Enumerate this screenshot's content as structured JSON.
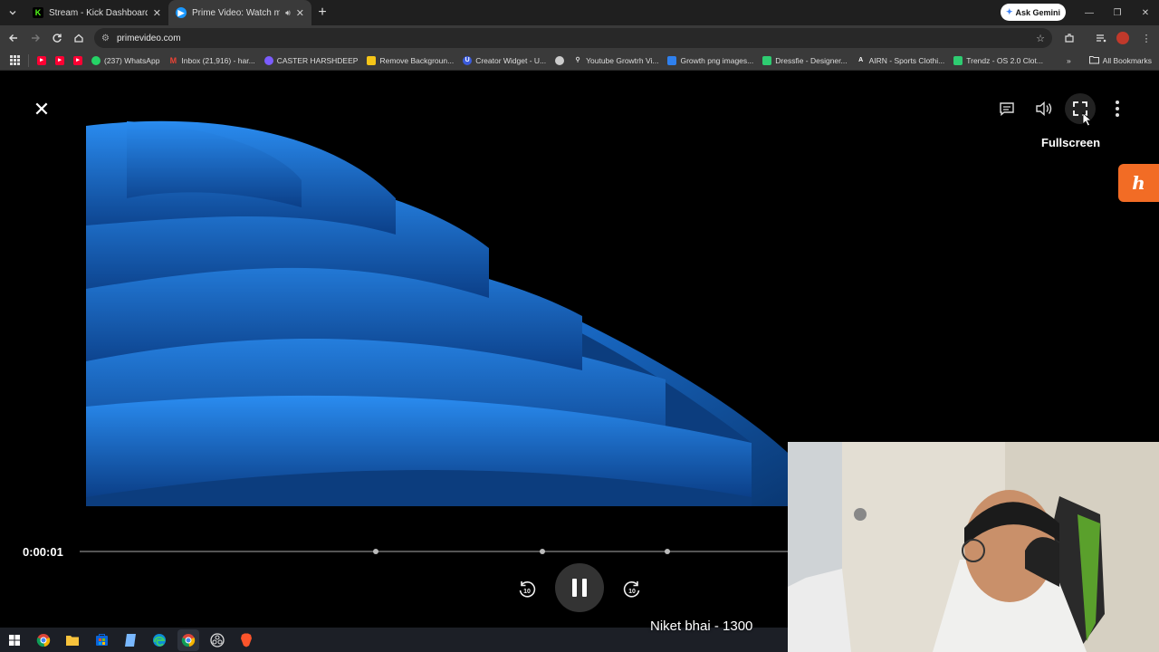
{
  "browser": {
    "tabs": [
      {
        "title": "Stream - Kick Dashboard",
        "favicon": "kick-icon",
        "favicon_color": "#53fc18",
        "active": false
      },
      {
        "title": "Prime Video: Watch movies",
        "favicon": "prime-video-icon",
        "favicon_color": "#1a98ff",
        "active": true
      }
    ],
    "ask_gemini": "Ask Gemini",
    "url": "primevideo.com",
    "bookmarks": [
      {
        "label": "",
        "icon": "youtube-icon",
        "color": "#ff0033"
      },
      {
        "label": "",
        "icon": "youtube-icon",
        "color": "#ff0033"
      },
      {
        "label": "",
        "icon": "youtube-icon",
        "color": "#ff0033"
      },
      {
        "label": "(237) WhatsApp",
        "icon": "whatsapp-icon",
        "color": "#25d366"
      },
      {
        "label": "Inbox (21,916) - har...",
        "icon": "gmail-icon",
        "color": "#ea4335"
      },
      {
        "label": "CASTER HARSHDEEP",
        "icon": "dashboard-icon",
        "color": "#7b5cff"
      },
      {
        "label": "Remove Backgroun...",
        "icon": "removebg-icon",
        "color": "#f5c518"
      },
      {
        "label": "Creator Widget - U...",
        "icon": "creator-widget-icon",
        "color": "#3b5bdb"
      },
      {
        "label": "",
        "icon": "globe-icon",
        "color": "#cccccc"
      },
      {
        "label": "Youtube Growtrh Vi...",
        "icon": "pin-icon",
        "color": "#dddddd"
      },
      {
        "label": "Growth png images...",
        "icon": "pngtree-icon",
        "color": "#2f80ed"
      },
      {
        "label": "Dressfie - Designer...",
        "icon": "dressfie-icon",
        "color": "#2ecc71"
      },
      {
        "label": "AIRN - Sports Clothi...",
        "icon": "airn-icon",
        "color": "#ffffff"
      },
      {
        "label": "Trendz - OS 2.0 Clot...",
        "icon": "trendz-icon",
        "color": "#2ecc71"
      }
    ],
    "all_bookmarks": "All Bookmarks"
  },
  "player": {
    "tooltip": "Fullscreen",
    "current_time": "0:00:01",
    "progress_fraction": 0.0
  },
  "overlay": {
    "text": "Niket bhai - 1300"
  },
  "taskbar": {
    "items": [
      "windows-start-icon",
      "chrome-icon",
      "file-explorer-icon",
      "store-icon",
      "notepad-icon",
      "edge-icon",
      "chrome-profile-icon",
      "obs-icon",
      "brave-icon"
    ]
  }
}
